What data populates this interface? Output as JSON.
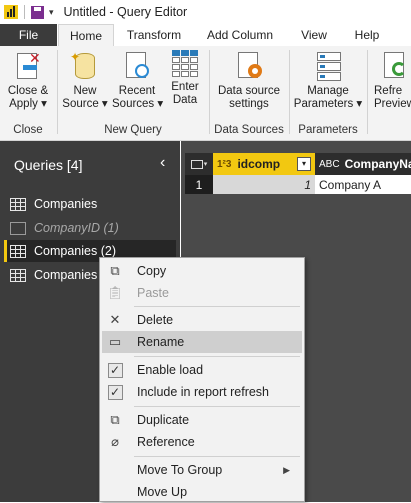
{
  "window": {
    "title": "Untitled - Query Editor"
  },
  "tabs": [
    {
      "label": "File"
    },
    {
      "label": "Home"
    },
    {
      "label": "Transform"
    },
    {
      "label": "Add Column"
    },
    {
      "label": "View"
    },
    {
      "label": "Help"
    }
  ],
  "ribbon": {
    "close": {
      "group": "Close",
      "button_line1": "Close &",
      "button_line2": "Apply",
      "dropdown": "▾"
    },
    "new_query": {
      "group": "New Query",
      "new_source": {
        "line1": "New",
        "line2": "Source",
        "dropdown": "▾"
      },
      "recent_sources": {
        "line1": "Recent",
        "line2": "Sources",
        "dropdown": "▾"
      },
      "enter_data": {
        "line1": "Enter",
        "line2": "Data"
      }
    },
    "data_sources": {
      "group": "Data Sources",
      "line1": "Data source",
      "line2": "settings"
    },
    "parameters": {
      "group": "Parameters",
      "line1": "Manage",
      "line2": "Parameters",
      "dropdown": "▾"
    },
    "refresh": {
      "line1": "Refre",
      "line2": "Preview"
    }
  },
  "queries": {
    "header": "Queries [4]",
    "collapse": "‹",
    "items": [
      {
        "label": "Companies",
        "icon": "table-icon"
      },
      {
        "label": "CompanyID (1)",
        "icon": "parameter-icon"
      },
      {
        "label": "Companies (2)",
        "icon": "table-icon"
      },
      {
        "label": "Companies (",
        "icon": "table-icon"
      }
    ]
  },
  "grid": {
    "columns": [
      {
        "type": "1²3",
        "name": "idcomp"
      },
      {
        "type": "ABC",
        "name": "CompanyNam"
      }
    ],
    "rows": [
      {
        "num": "1",
        "idcomp": "1",
        "name": "Company A"
      }
    ]
  },
  "context_menu": {
    "items": [
      {
        "label": "Copy"
      },
      {
        "label": "Paste"
      },
      {
        "label": "Delete"
      },
      {
        "label": "Rename"
      },
      {
        "label": "Enable load"
      },
      {
        "label": "Include in report refresh"
      },
      {
        "label": "Duplicate"
      },
      {
        "label": "Reference"
      },
      {
        "label": "Move To Group"
      },
      {
        "label": "Move Up"
      }
    ]
  },
  "colors": {
    "accent": "#f2c811",
    "file_tab": "#3b3b3b",
    "pane": "#3c3c3c"
  }
}
